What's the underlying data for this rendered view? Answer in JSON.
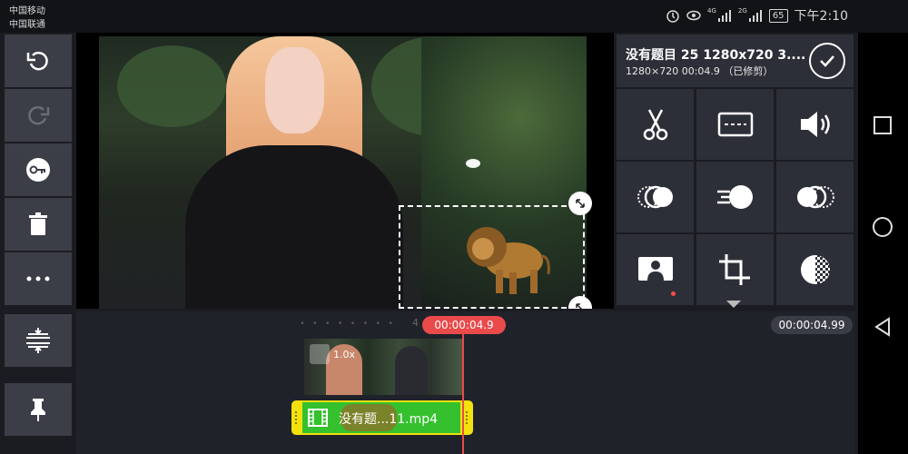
{
  "status_bar": {
    "carrier1": "中国移动",
    "carrier2": "中国联通",
    "net1": "4G",
    "net2": "2G",
    "battery": "65",
    "time": "下午2:10"
  },
  "left_toolbar": {
    "items": [
      "undo-icon",
      "redo-icon",
      "keyframe-icon",
      "delete-icon",
      "more-icon"
    ],
    "timeline_items": [
      "split-track-icon",
      "pin-icon"
    ]
  },
  "project": {
    "title": "没有题目 25 1280x720 3....",
    "info": "1280×720  00:04.9 （已修剪）"
  },
  "tools": [
    "scissors-icon",
    "subtitle-icon",
    "volume-icon",
    "blend-icon",
    "speed-icon",
    "transition-icon",
    "chroma-key-icon",
    "crop-icon",
    "opacity-icon"
  ],
  "timeline": {
    "marker_number": "4",
    "playhead_time": "00:00:04.9",
    "total_time": "00:00:04.99",
    "video_clip_speed": "1.0x",
    "layer_clip_label": "没有题...11.mp4"
  },
  "colors": {
    "accent": "#ea4a4a",
    "layer_selected": "#f3e10d",
    "layer_fill": "#35c02e",
    "panel": "#2d2f38"
  }
}
